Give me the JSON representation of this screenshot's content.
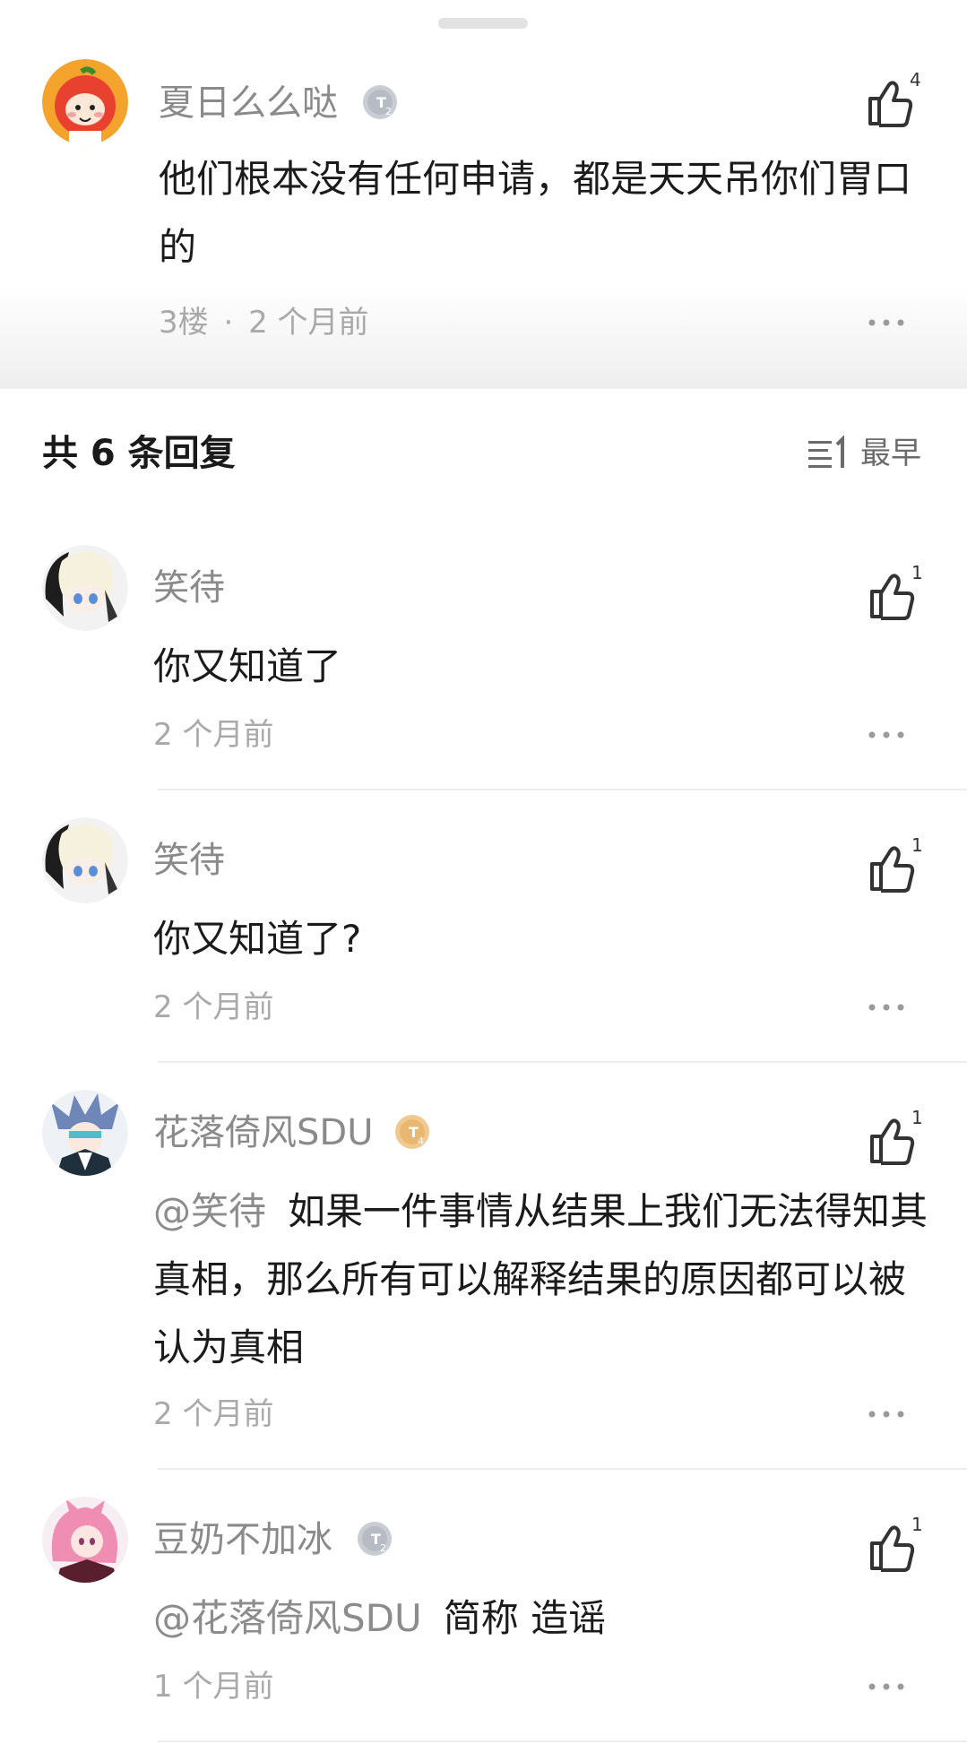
{
  "main_post": {
    "username": "夏日么么哒",
    "level_badge": "T2",
    "likes": "4",
    "content": "他们根本没有任何申请，都是天天吊你们胃口的",
    "floor": "3楼",
    "separator": "·",
    "time": "2 个月前"
  },
  "replies_header": {
    "title": "共 6 条回复",
    "sort_icon_text": "≡1",
    "sort_label": "最早"
  },
  "replies": [
    {
      "username": "笑待",
      "likes": "1",
      "mention": "",
      "content": "你又知道了",
      "time": "2 个月前"
    },
    {
      "username": "笑待",
      "likes": "1",
      "mention": "",
      "content": "你又知道了?",
      "time": "2 个月前"
    },
    {
      "username": "花落倚风SDU",
      "level_badge": "T4",
      "likes": "1",
      "mention": "@笑待",
      "content": "如果一件事情从结果上我们无法得知其真相，那么所有可以解释结果的原因都可以被认为真相",
      "time": "2 个月前"
    },
    {
      "username": "豆奶不加冰",
      "level_badge": "T2",
      "likes": "1",
      "mention": "@花落倚风SDU",
      "content": "简称 造谣",
      "time": "1 个月前"
    }
  ],
  "icons": {
    "like": "thumbs-up-icon",
    "more": "more-dots-icon",
    "sort": "sort-order-icon",
    "badge": "level-badge-icon"
  },
  "colors": {
    "badge_silver": "#b7bcc4",
    "badge_gold": "#e8b772",
    "text_muted": "#a9a9a9",
    "divider": "#ececec"
  }
}
